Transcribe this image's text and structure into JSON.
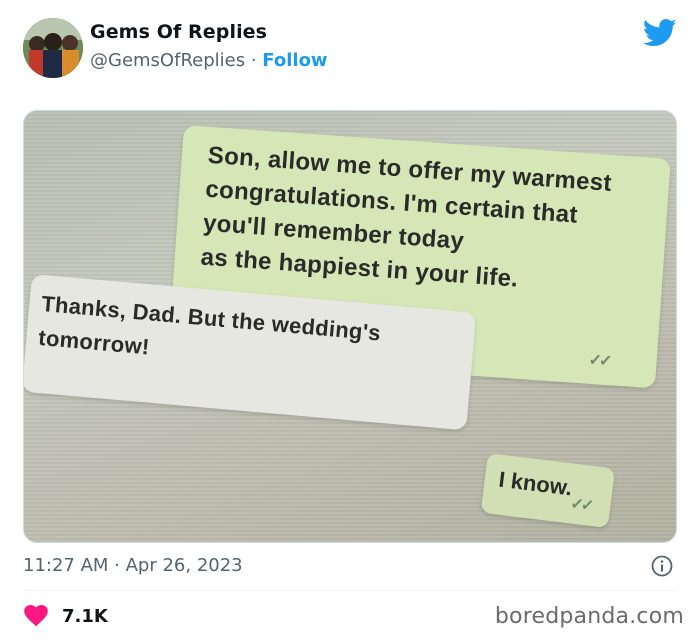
{
  "author": {
    "name": "Gems Of Replies",
    "handle": "@GemsOfReplies",
    "separator": "·",
    "follow_label": "Follow"
  },
  "media": {
    "outgoing_message": {
      "lines": [
        "Son, allow me to offer my warmest",
        "congratulations. I'm certain that",
        "you'll remember today",
        "as the happiest in your life."
      ]
    },
    "incoming_message": {
      "lines": [
        "Thanks, Dad. But the wedding's",
        "tomorrow!"
      ]
    },
    "reply_message": {
      "text": "I know."
    },
    "read_ticks": "✓✓"
  },
  "timestamp": "11:27 AM · Apr 26, 2023",
  "likes": {
    "count": "7.1K"
  },
  "watermark": "boredpanda.com",
  "colors": {
    "accent": "#1d9bf0",
    "heart": "#f91880",
    "muted_text": "#536471"
  },
  "icons": [
    "twitter-bird-icon",
    "info-icon",
    "heart-icon"
  ]
}
